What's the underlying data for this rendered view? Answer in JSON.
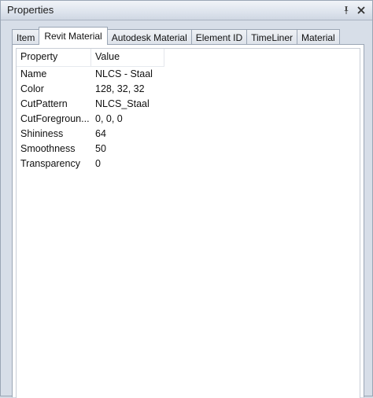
{
  "window": {
    "title": "Properties",
    "pin_icon": "pin-icon",
    "close_icon": "close-icon"
  },
  "tabs": [
    {
      "label": "Item"
    },
    {
      "label": "Revit Material",
      "active": true
    },
    {
      "label": "Autodesk Material"
    },
    {
      "label": "Element ID"
    },
    {
      "label": "TimeLiner"
    },
    {
      "label": "Material"
    }
  ],
  "table": {
    "headers": {
      "property": "Property",
      "value": "Value"
    },
    "rows": [
      {
        "property": "Name",
        "value": "NLCS - Staal"
      },
      {
        "property": "Color",
        "value": "128, 32, 32"
      },
      {
        "property": "CutPattern",
        "value": "NLCS_Staal"
      },
      {
        "property": "CutForegroun...",
        "value": "0, 0, 0"
      },
      {
        "property": "Shininess",
        "value": "64"
      },
      {
        "property": "Smoothness",
        "value": "50"
      },
      {
        "property": "Transparency",
        "value": "0"
      }
    ]
  }
}
